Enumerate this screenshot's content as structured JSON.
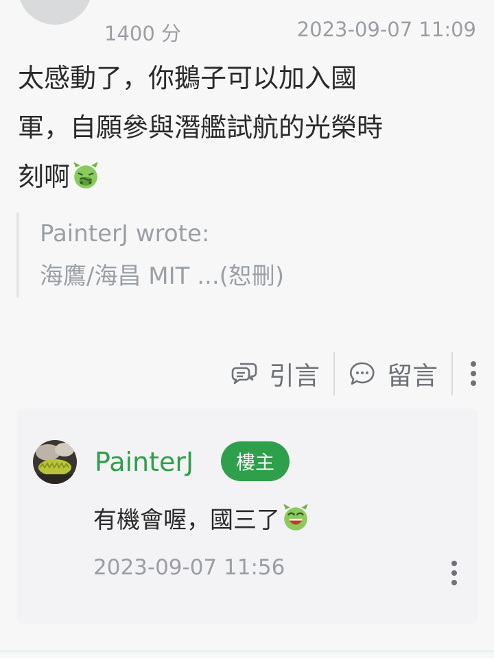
{
  "post": {
    "score": "1400 分",
    "timestamp": "2023-09-07 11:09",
    "body_line1": "太感動了，你鵝子可以加入國",
    "body_line2": "軍，自願參與潛艦試航的光榮時",
    "body_line3": "刻啊",
    "emoji": "nauseated-emoji",
    "quote": {
      "author_line": "PainterJ wrote:",
      "text": "海鷹/海昌 MIT ...(恕刪)"
    }
  },
  "actions": {
    "quote_label": "引言",
    "comment_label": "留言",
    "quote_icon": "speech-bubbles-icon",
    "comment_icon": "chat-bubble-icon",
    "more_icon": "vertical-dots-icon"
  },
  "reply": {
    "author": "PainterJ",
    "badge": "樓主",
    "text": "有機會喔，國三了",
    "emoji": "grinning-emoji",
    "timestamp": "2023-09-07 11:56"
  },
  "colors": {
    "accent_green": "#2e9f4a",
    "muted_text": "#9a9ea4",
    "background": "#f7f7f8"
  }
}
